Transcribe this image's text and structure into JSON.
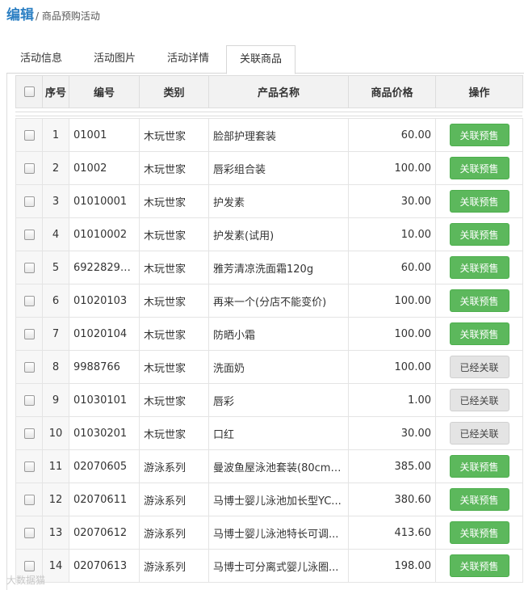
{
  "header": {
    "title": "编辑",
    "breadcrumb": "/ 商品预购活动"
  },
  "tabs": [
    {
      "label": "活动信息",
      "active": false
    },
    {
      "label": "活动图片",
      "active": false
    },
    {
      "label": "活动详情",
      "active": false
    },
    {
      "label": "关联商品",
      "active": true
    }
  ],
  "table": {
    "columns": [
      "序号",
      "编号",
      "类别",
      "产品名称",
      "商品价格",
      "操作"
    ],
    "rows": [
      {
        "seq": "1",
        "code": "01001",
        "category": "木玩世家",
        "name": "脸部护理套装",
        "price": "60.00",
        "action": "关联预售",
        "action_state": "enabled"
      },
      {
        "seq": "2",
        "code": "01002",
        "category": "木玩世家",
        "name": "唇彩组合装",
        "price": "100.00",
        "action": "关联预售",
        "action_state": "enabled"
      },
      {
        "seq": "3",
        "code": "01010001",
        "category": "木玩世家",
        "name": "护发素",
        "price": "30.00",
        "action": "关联预售",
        "action_state": "enabled"
      },
      {
        "seq": "4",
        "code": "01010002",
        "category": "木玩世家",
        "name": "护发素(试用)",
        "price": "10.00",
        "action": "关联预售",
        "action_state": "enabled"
      },
      {
        "seq": "5",
        "code": "69228295...",
        "category": "木玩世家",
        "name": "雅芳清凉洗面霜120g",
        "price": "60.00",
        "action": "关联预售",
        "action_state": "enabled"
      },
      {
        "seq": "6",
        "code": "01020103",
        "category": "木玩世家",
        "name": "再来一个(分店不能变价)",
        "price": "100.00",
        "action": "关联预售",
        "action_state": "enabled"
      },
      {
        "seq": "7",
        "code": "01020104",
        "category": "木玩世家",
        "name": "防晒小霜",
        "price": "100.00",
        "action": "关联预售",
        "action_state": "enabled"
      },
      {
        "seq": "8",
        "code": "9988766",
        "category": "木玩世家",
        "name": "洗面奶",
        "price": "100.00",
        "action": "已经关联",
        "action_state": "disabled"
      },
      {
        "seq": "9",
        "code": "01030101",
        "category": "木玩世家",
        "name": "唇彩",
        "price": "1.00",
        "action": "已经关联",
        "action_state": "disabled"
      },
      {
        "seq": "10",
        "code": "01030201",
        "category": "木玩世家",
        "name": "口红",
        "price": "30.00",
        "action": "已经关联",
        "action_state": "disabled"
      },
      {
        "seq": "11",
        "code": "02070605",
        "category": "游泳系列",
        "name": "曼波鱼屋泳池套装(80cm*...",
        "price": "385.00",
        "action": "关联预售",
        "action_state": "enabled"
      },
      {
        "seq": "12",
        "code": "02070611",
        "category": "游泳系列",
        "name": "马博士婴儿泳池加长型YC...",
        "price": "380.60",
        "action": "关联预售",
        "action_state": "enabled"
      },
      {
        "seq": "13",
        "code": "02070612",
        "category": "游泳系列",
        "name": "马博士婴儿泳池特长可调...",
        "price": "413.60",
        "action": "关联预售",
        "action_state": "enabled"
      },
      {
        "seq": "14",
        "code": "02070613",
        "category": "游泳系列",
        "name": "马博士可分离式婴儿泳圈...",
        "price": "198.00",
        "action": "关联预售",
        "action_state": "enabled"
      }
    ]
  },
  "watermark": "大数据猫",
  "colors": {
    "accent": "#2b7fc3",
    "button_green": "#5cb85c",
    "button_gray": "#e4e4e4"
  }
}
